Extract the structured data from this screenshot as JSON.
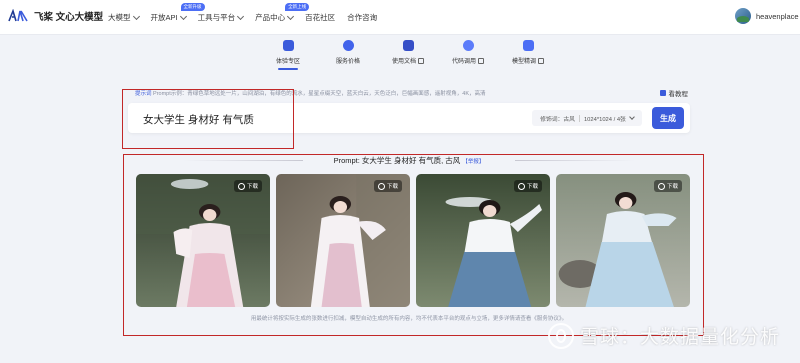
{
  "brand": {
    "name": "飞桨 文心大模型"
  },
  "nav": {
    "items": [
      {
        "label": "大模型",
        "has_menu": true
      },
      {
        "label": "开放API",
        "has_menu": true,
        "badge": "全新升级"
      },
      {
        "label": "工具与平台",
        "has_menu": true
      },
      {
        "label": "产品中心",
        "has_menu": true,
        "badge": "全新上线"
      },
      {
        "label": "百花社区",
        "has_menu": false
      },
      {
        "label": "合作咨询",
        "has_menu": false
      }
    ]
  },
  "user": {
    "name": "heavenplace"
  },
  "tabs": [
    {
      "label": "体验专区",
      "icon": "experience-icon",
      "active": true,
      "external": false
    },
    {
      "label": "服务价格",
      "icon": "price-icon",
      "active": false,
      "external": false
    },
    {
      "label": "使用文档",
      "icon": "docs-icon",
      "active": false,
      "external": true
    },
    {
      "label": "代码调用",
      "icon": "code-icon",
      "active": false,
      "external": true
    },
    {
      "label": "模型精调",
      "icon": "tuning-icon",
      "active": false,
      "external": true
    }
  ],
  "prompt": {
    "hint_title": "提示词",
    "hint_text": "Prompt示例：青绿色草地远处一片，山间湖泊，有绿色的流水，星星点缀天空，蓝天白云，天色泛白，巨幅画面感，遥射视角，4K，高清",
    "help_label": "看教程",
    "value": "女大学生 身材好  有气质",
    "style_label": "修饰词：古风",
    "size_label": "1024*1024 / 4张",
    "generate_label": "生成"
  },
  "results": {
    "header": "Prompt: 女大学生 身材好 有气质, 古风",
    "report_label": "【举报】",
    "download_label": "下载",
    "images": [
      {
        "name": "hanfu-image-1",
        "colors": {
          "bg": "#4c5a4a",
          "dress": "#f1e6ea",
          "accent": "#e4b6c3"
        }
      },
      {
        "name": "hanfu-image-2",
        "colors": {
          "bg": "#8d8377",
          "dress": "#f4f0f2",
          "accent": "#d4a2b8"
        }
      },
      {
        "name": "hanfu-image-3",
        "colors": {
          "bg": "#5a6a52",
          "dress": "#f2f4f6",
          "accent": "#6a8fb5"
        }
      },
      {
        "name": "hanfu-image-4",
        "colors": {
          "bg": "#9aa094",
          "dress": "#cfe2ee",
          "accent": "#a9cbe1"
        }
      }
    ],
    "footer_note": "用最统计将按实际生成的张数进行扣减，模型自动生成的所有内容，均不代表本平台的观点与立场，更多详情请查看《服务协议》。"
  },
  "watermark": {
    "text": "雪球：大数据量化分析"
  },
  "colors": {
    "accent": "#3b5bdb",
    "annotation": "#c22828",
    "background": "#f1f3f8"
  }
}
